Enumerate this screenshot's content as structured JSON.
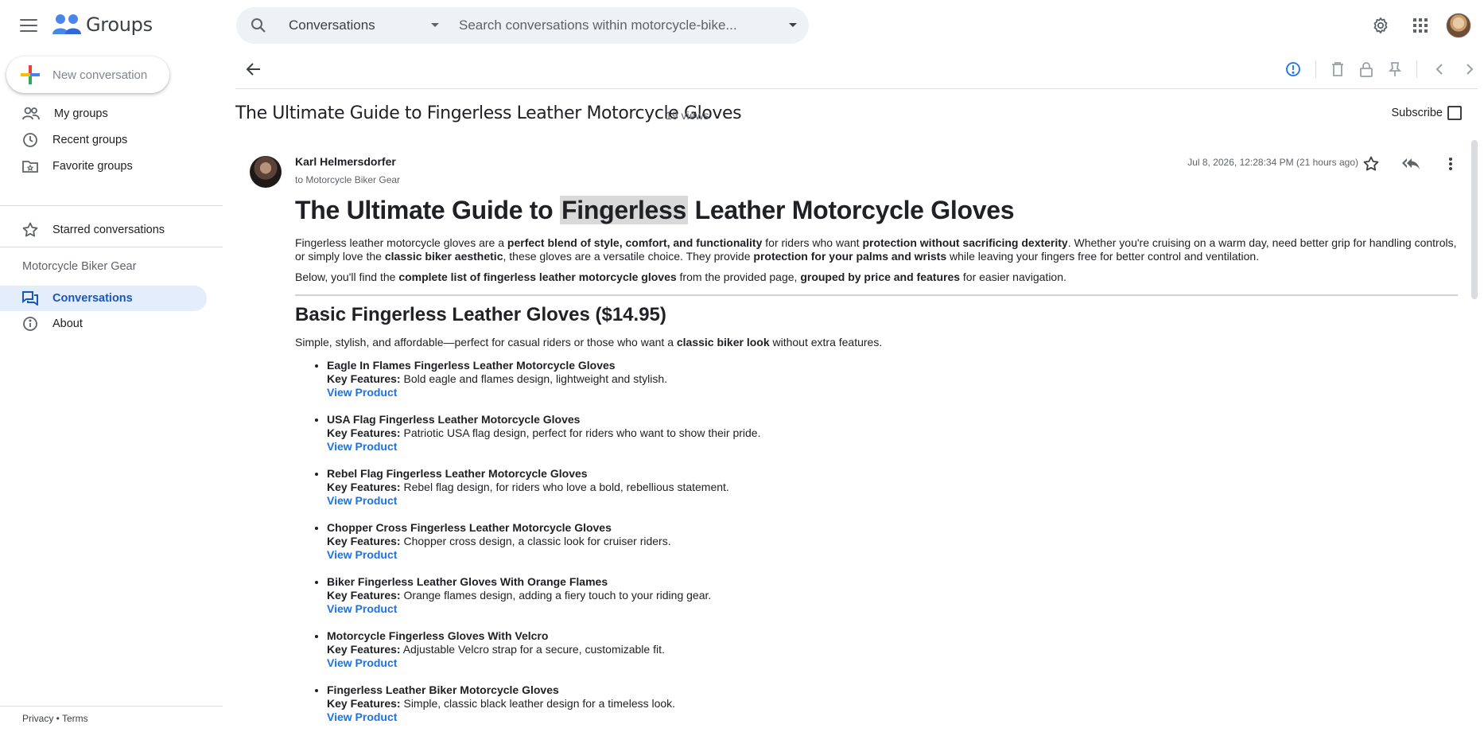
{
  "app": {
    "name": "Groups"
  },
  "colors": {
    "accent": "#1a73e8",
    "active_bg": "#e3edfb",
    "active_text": "#1a56b8"
  },
  "search": {
    "scope": "Conversations",
    "placeholder": "Search conversations within motorcycle-bike..."
  },
  "sidebar": {
    "new_conversation": "New conversation",
    "items": [
      {
        "label": "My groups",
        "icon": "people-icon"
      },
      {
        "label": "Recent groups",
        "icon": "clock-icon"
      },
      {
        "label": "Favorite groups",
        "icon": "folder-star-icon"
      }
    ],
    "starred": "Starred conversations",
    "group_name": "Motorcycle Biker Gear",
    "group_items": [
      {
        "label": "Conversations",
        "icon": "forum-icon",
        "active": true
      },
      {
        "label": "About",
        "icon": "info-icon",
        "active": false
      }
    ],
    "footer": {
      "privacy": "Privacy",
      "sep": " • ",
      "terms": "Terms"
    }
  },
  "thread": {
    "title": "The Ultimate Guide to Fingerless Leather Motorcycle Gloves",
    "views": "19 views",
    "subscribe": "Subscribe"
  },
  "post": {
    "author": "Karl Helmersdorfer",
    "to": "to Motorcycle Biker Gear",
    "date": "Jul 8, 2026, 12:28:34 PM (21 hours ago)",
    "h1_before": "The Ultimate Guide to ",
    "h1_highlight": "Fingerless",
    "h1_after": " Leather Motorcycle Gloves",
    "intro": {
      "t1": "Fingerless leather motorcycle gloves are a ",
      "b1": "perfect blend of style, comfort, and functionality",
      "t2": " for riders who want ",
      "b2": "protection without sacrificing dexterity",
      "t3": ". Whether you're cruising on a warm day, need better grip for handling controls, or simply love the ",
      "b3": "classic biker aesthetic",
      "t4": ", these gloves are a versatile choice. They provide ",
      "b4": "protection for your palms and wrists",
      "t5": " while leaving your fingers free for better control and ventilation."
    },
    "below": {
      "t1": "Below, you'll find the ",
      "b1": "complete list of fingerless leather motorcycle gloves",
      "t2": " from the provided page, ",
      "b2": "grouped by price and features",
      "t3": " for easier navigation."
    },
    "section_title": "Basic Fingerless Leather Gloves ($14.95)",
    "section_intro": {
      "t1": "Simple, stylish, and affordable—perfect for casual riders or those who want a ",
      "b1": "classic biker look",
      "t2": " without extra features."
    },
    "key_label": "Key Features:",
    "link_label": "View Product",
    "products": [
      {
        "name": "Eagle In Flames Fingerless Leather Motorcycle Gloves",
        "features": " Bold eagle and flames design, lightweight and stylish."
      },
      {
        "name": "USA Flag Fingerless Leather Motorcycle Gloves",
        "features": " Patriotic USA flag design, perfect for riders who want to show their pride."
      },
      {
        "name": "Rebel Flag Fingerless Leather Motorcycle Gloves",
        "features": " Rebel flag design, for riders who love a bold, rebellious statement."
      },
      {
        "name": "Chopper Cross Fingerless Leather Motorcycle Gloves",
        "features": " Chopper cross design, a classic look for cruiser riders."
      },
      {
        "name": "Biker Fingerless Leather Gloves With Orange Flames",
        "features": " Orange flames design, adding a fiery touch to your riding gear."
      },
      {
        "name": "Motorcycle Fingerless Gloves With Velcro",
        "features": " Adjustable Velcro strap for a secure, customizable fit."
      },
      {
        "name": "Fingerless Leather Biker Motorcycle Gloves",
        "features": " Simple, classic black leather design for a timeless look."
      }
    ]
  }
}
